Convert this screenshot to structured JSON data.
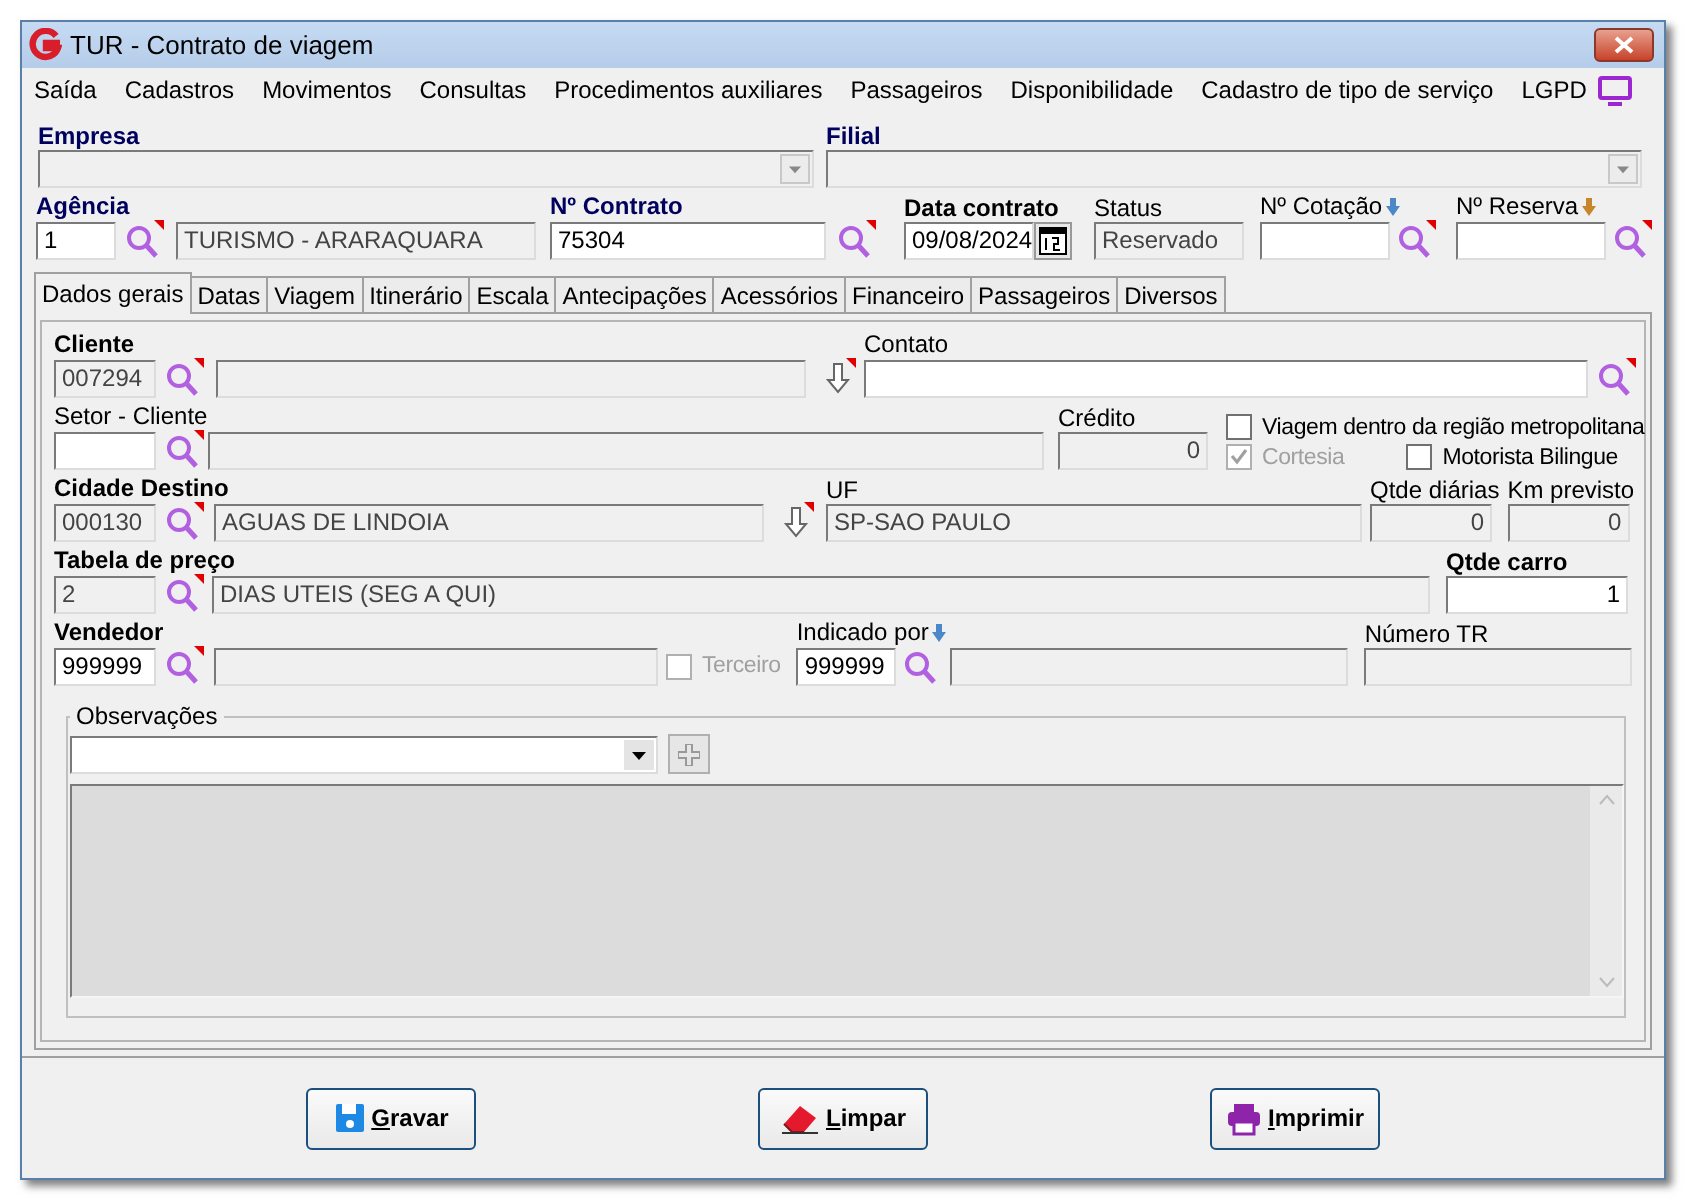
{
  "window": {
    "title": "TUR - Contrato de viagem"
  },
  "menu": [
    "Saída",
    "Cadastros",
    "Movimentos",
    "Consultas",
    "Procedimentos auxiliares",
    "Passageiros",
    "Disponibilidade",
    "Cadastro de tipo de serviço",
    "LGPD"
  ],
  "header": {
    "empresa": {
      "label": "Empresa"
    },
    "filial": {
      "label": "Filial"
    },
    "agencia": {
      "label": "Agência",
      "code": "1",
      "name": "TURISMO - ARARAQUARA"
    },
    "contrato": {
      "label": "Nº Contrato",
      "value": "75304"
    },
    "data_contrato": {
      "label": "Data contrato",
      "value": "09/08/2024"
    },
    "status": {
      "label": "Status",
      "value": "Reservado"
    },
    "cotacao": {
      "label": "Nº Cotação"
    },
    "reserva": {
      "label": "Nº Reserva"
    }
  },
  "tabs": [
    {
      "label": "Dados gerais",
      "selected": true
    },
    {
      "label": "Datas",
      "selected": false
    },
    {
      "label": "Viagem",
      "selected": false
    },
    {
      "label": "Itinerário",
      "selected": false
    },
    {
      "label": "Escala",
      "selected": false
    },
    {
      "label": "Antecipações",
      "selected": false
    },
    {
      "label": "Acessórios",
      "selected": false
    },
    {
      "label": "Financeiro",
      "selected": false
    },
    {
      "label": "Passageiros",
      "selected": false
    },
    {
      "label": "Diversos",
      "selected": false
    }
  ],
  "general": {
    "cliente": {
      "label": "Cliente",
      "code": "007294"
    },
    "contato": {
      "label": "Contato"
    },
    "setor": {
      "label": "Setor - Cliente"
    },
    "credito": {
      "label": "Crédito",
      "value": "0"
    },
    "options": [
      {
        "label": "Viagem dentro da região metropolitana",
        "checked": false,
        "disabled": false
      },
      {
        "label": "Cortesia",
        "checked": true,
        "disabled": true
      },
      {
        "label": "Motorista Bilingue",
        "checked": false,
        "disabled": false
      }
    ],
    "cidade": {
      "label": "Cidade Destino",
      "code": "000130",
      "name": "AGUAS DE LINDOIA"
    },
    "uf": {
      "label": "UF",
      "value": "SP-SAO PAULO"
    },
    "diarias": {
      "label": "Qtde diárias",
      "value": "0"
    },
    "km": {
      "label": "Km previsto",
      "value": "0"
    },
    "tabela": {
      "label": "Tabela de preço",
      "code": "2",
      "name": "DIAS UTEIS (SEG A QUI)"
    },
    "qtde_carro": {
      "label": "Qtde carro",
      "value": "1"
    },
    "vendedor": {
      "label": "Vendedor",
      "code": "999999"
    },
    "terceiro": {
      "label": "Terceiro",
      "checked": false,
      "disabled": true
    },
    "indicado": {
      "label": "Indicado por",
      "code": "999999"
    },
    "numero_tr": {
      "label": "Número TR"
    },
    "observacoes": {
      "label": "Observações"
    }
  },
  "buttons": [
    {
      "label": "Gravar",
      "kind": "save"
    },
    {
      "label": "Limpar",
      "kind": "clear"
    },
    {
      "label": "Imprimir",
      "kind": "print"
    }
  ]
}
